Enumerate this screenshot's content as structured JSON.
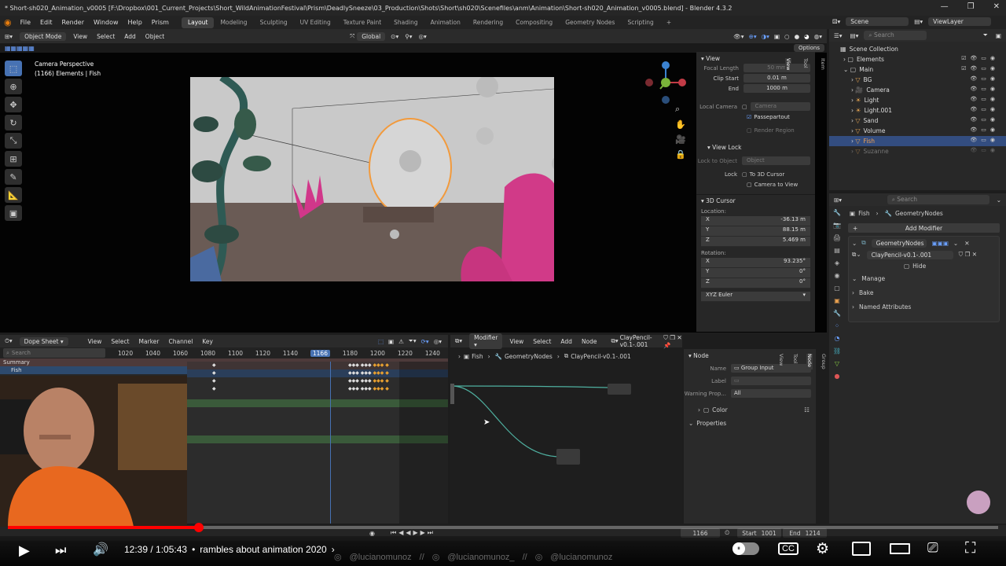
{
  "window": {
    "title": "* Short-sh020_Animation_v0005 [F:\\Dropbox\\001_Current_Projects\\Short_WildAnimationFestival\\Prism\\DeadlySneeze\\03_Production\\Shots\\Short\\sh020\\Scenefiles\\anm\\Animation\\Short-sh020_Animation_v0005.blend] - Blender 4.3.2",
    "min": "—",
    "max": "❐",
    "close": "✕"
  },
  "menus": [
    "File",
    "Edit",
    "Render",
    "Window",
    "Help",
    "Prism"
  ],
  "workspaces": [
    "Layout",
    "Modeling",
    "Sculpting",
    "UV Editing",
    "Texture Paint",
    "Shading",
    "Animation",
    "Rendering",
    "Compositing",
    "Geometry Nodes",
    "Scripting"
  ],
  "workspace_add": "+",
  "scene": {
    "label": "Scene",
    "viewlayer": "ViewLayer"
  },
  "viewport_header": {
    "mode": "Object Mode",
    "menus": [
      "View",
      "Select",
      "Add",
      "Object"
    ],
    "orientation": "Global",
    "options": "Options"
  },
  "viewport": {
    "camera_label": "Camera Perspective",
    "elements_label": "(1166) Elements | Fish"
  },
  "npanel": {
    "tabs": [
      "Item",
      "Tool",
      "View"
    ],
    "view_title": "View",
    "focal_label": "Focal Length",
    "focal_value": "50 mm",
    "clip_start_label": "Clip Start",
    "clip_start_value": "0.01 m",
    "end_label": "End",
    "end_value": "1000 m",
    "local_camera_label": "Local Camera",
    "local_camera_value": "Camera",
    "passepartout_label": "Passepartout",
    "render_region_label": "Render Region",
    "view_lock_title": "View Lock",
    "lock_to_object_label": "Lock to Object",
    "lock_to_object_value": "Object",
    "lock_label": "Lock",
    "to_3d_cursor_label": "To 3D Cursor",
    "camera_to_view_label": "Camera to View",
    "cursor_title": "3D Cursor",
    "location_label": "Location:",
    "loc_x": "-36.13 m",
    "loc_y": "88.15 m",
    "loc_z": "5.469 m",
    "rotation_label": "Rotation:",
    "rot_x": "93.235°",
    "rot_y": "0°",
    "rot_z": "0°",
    "rot_mode": "XYZ Euler",
    "x": "X",
    "y": "Y",
    "z": "Z"
  },
  "outliner": {
    "search_placeholder": "Search",
    "root": "Scene Collection",
    "items": [
      "Elements",
      "Main",
      "BG",
      "Camera",
      "Light",
      "Light.001",
      "Sand",
      "Volume",
      "Fish",
      "Suzanne"
    ]
  },
  "properties": {
    "search_placeholder": "Search",
    "breadcrumb_object": "Fish",
    "breadcrumb_modifier": "GeometryNodes",
    "add_modifier": "Add Modifier",
    "modifier_name": "GeometryNodes",
    "node_group": "ClayPencil-v0.1-.001",
    "hide_label": "Hide",
    "sections": [
      "Manage",
      "Bake",
      "Named Attributes"
    ]
  },
  "dopesheet": {
    "mode": "Dope Sheet",
    "menus": [
      "View",
      "Select",
      "Marker",
      "Channel",
      "Key"
    ],
    "search_placeholder": "Search",
    "frames": [
      "1020",
      "1040",
      "1060",
      "1080",
      "1100",
      "1120",
      "1140",
      "1166",
      "1180",
      "1200",
      "1220",
      "1240"
    ],
    "current_frame": "1166",
    "channels": [
      "Summary",
      "Fish"
    ]
  },
  "node_editor": {
    "type": "Modifier",
    "menus": [
      "View",
      "Select",
      "Add",
      "Node"
    ],
    "node_group": "ClayPencil-v0.1-.001",
    "breadcrumb": [
      "Fish",
      "GeometryNodes",
      "ClayPencil-v0.1-.001"
    ]
  },
  "node_side": {
    "node_title": "Node",
    "name_label": "Name",
    "name_value": "Group Input",
    "label_label": "Label",
    "warning_label": "Warning Prop...",
    "warning_value": "All",
    "color_label": "Color",
    "properties_label": "Properties",
    "tabs": [
      "Group",
      "Node",
      "Tool",
      "View"
    ]
  },
  "timeline": {
    "current": "1166",
    "start_label": "Start",
    "start_value": "1001",
    "end_label": "End",
    "end_value": "1214"
  },
  "youtube": {
    "time": "12:39 / 1:05:43",
    "separator": "•",
    "chapter": "rambles about animation 2020",
    "chapter_arrow": "›",
    "progress": 0.193,
    "socials": [
      "@lucianomunoz",
      "//",
      "@lucianomunoz_",
      "//",
      "@lucianomunoz"
    ]
  },
  "colors": {
    "accent": "#4772b3",
    "selection": "#ed9541",
    "youtube_red": "#ff0000"
  }
}
